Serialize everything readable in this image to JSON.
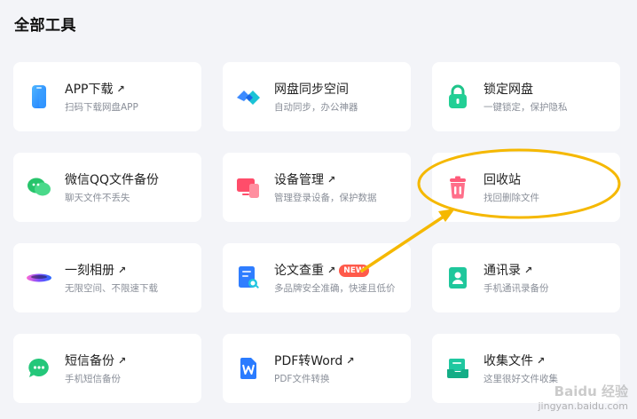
{
  "page_title": "全部工具",
  "tools": [
    {
      "id": "app",
      "title": "APP下载",
      "subtitle": "扫码下载网盘APP",
      "external": "↗",
      "icon": "phone-icon"
    },
    {
      "id": "sync",
      "title": "网盘同步空间",
      "subtitle": "自动同步，办公神器",
      "external": "",
      "icon": "sync-icon"
    },
    {
      "id": "lock",
      "title": "锁定网盘",
      "subtitle": "一键锁定，保护隐私",
      "external": "",
      "icon": "lock-icon"
    },
    {
      "id": "wechat",
      "title": "微信QQ文件备份",
      "subtitle": "聊天文件不丢失",
      "external": "",
      "icon": "chat-bubbles-icon"
    },
    {
      "id": "device",
      "title": "设备管理",
      "subtitle": "管理登录设备，保护数据",
      "external": "↗",
      "icon": "devices-icon"
    },
    {
      "id": "recycle",
      "title": "回收站",
      "subtitle": "找回删除文件",
      "external": "",
      "icon": "trash-icon"
    },
    {
      "id": "album",
      "title": "一刻相册",
      "subtitle": "无限空间、不限速下载",
      "external": "↗",
      "icon": "album-icon"
    },
    {
      "id": "paper",
      "title": "论文查重",
      "subtitle": "多品牌安全准确，快速且低价",
      "external": "↗",
      "badge": "NEW",
      "icon": "document-search-icon"
    },
    {
      "id": "contacts",
      "title": "通讯录",
      "subtitle": "手机通讯录备份",
      "external": "↗",
      "icon": "contact-icon"
    },
    {
      "id": "sms",
      "title": "短信备份",
      "subtitle": "手机短信备份",
      "external": "↗",
      "icon": "sms-icon"
    },
    {
      "id": "pdf",
      "title": "PDF转Word",
      "subtitle": "PDF文件转换",
      "external": "↗",
      "icon": "word-icon"
    },
    {
      "id": "collect",
      "title": "收集文件",
      "subtitle": "这里很好文件收集",
      "external": "↗",
      "icon": "collect-icon"
    }
  ],
  "colors": {
    "background": "#f3f4f8",
    "card": "#ffffff",
    "annotation": "#f5b800",
    "badge": "#ff5a4b"
  },
  "watermark": {
    "main": "Baidu 经验",
    "sub": "jingyan.baidu.com"
  }
}
